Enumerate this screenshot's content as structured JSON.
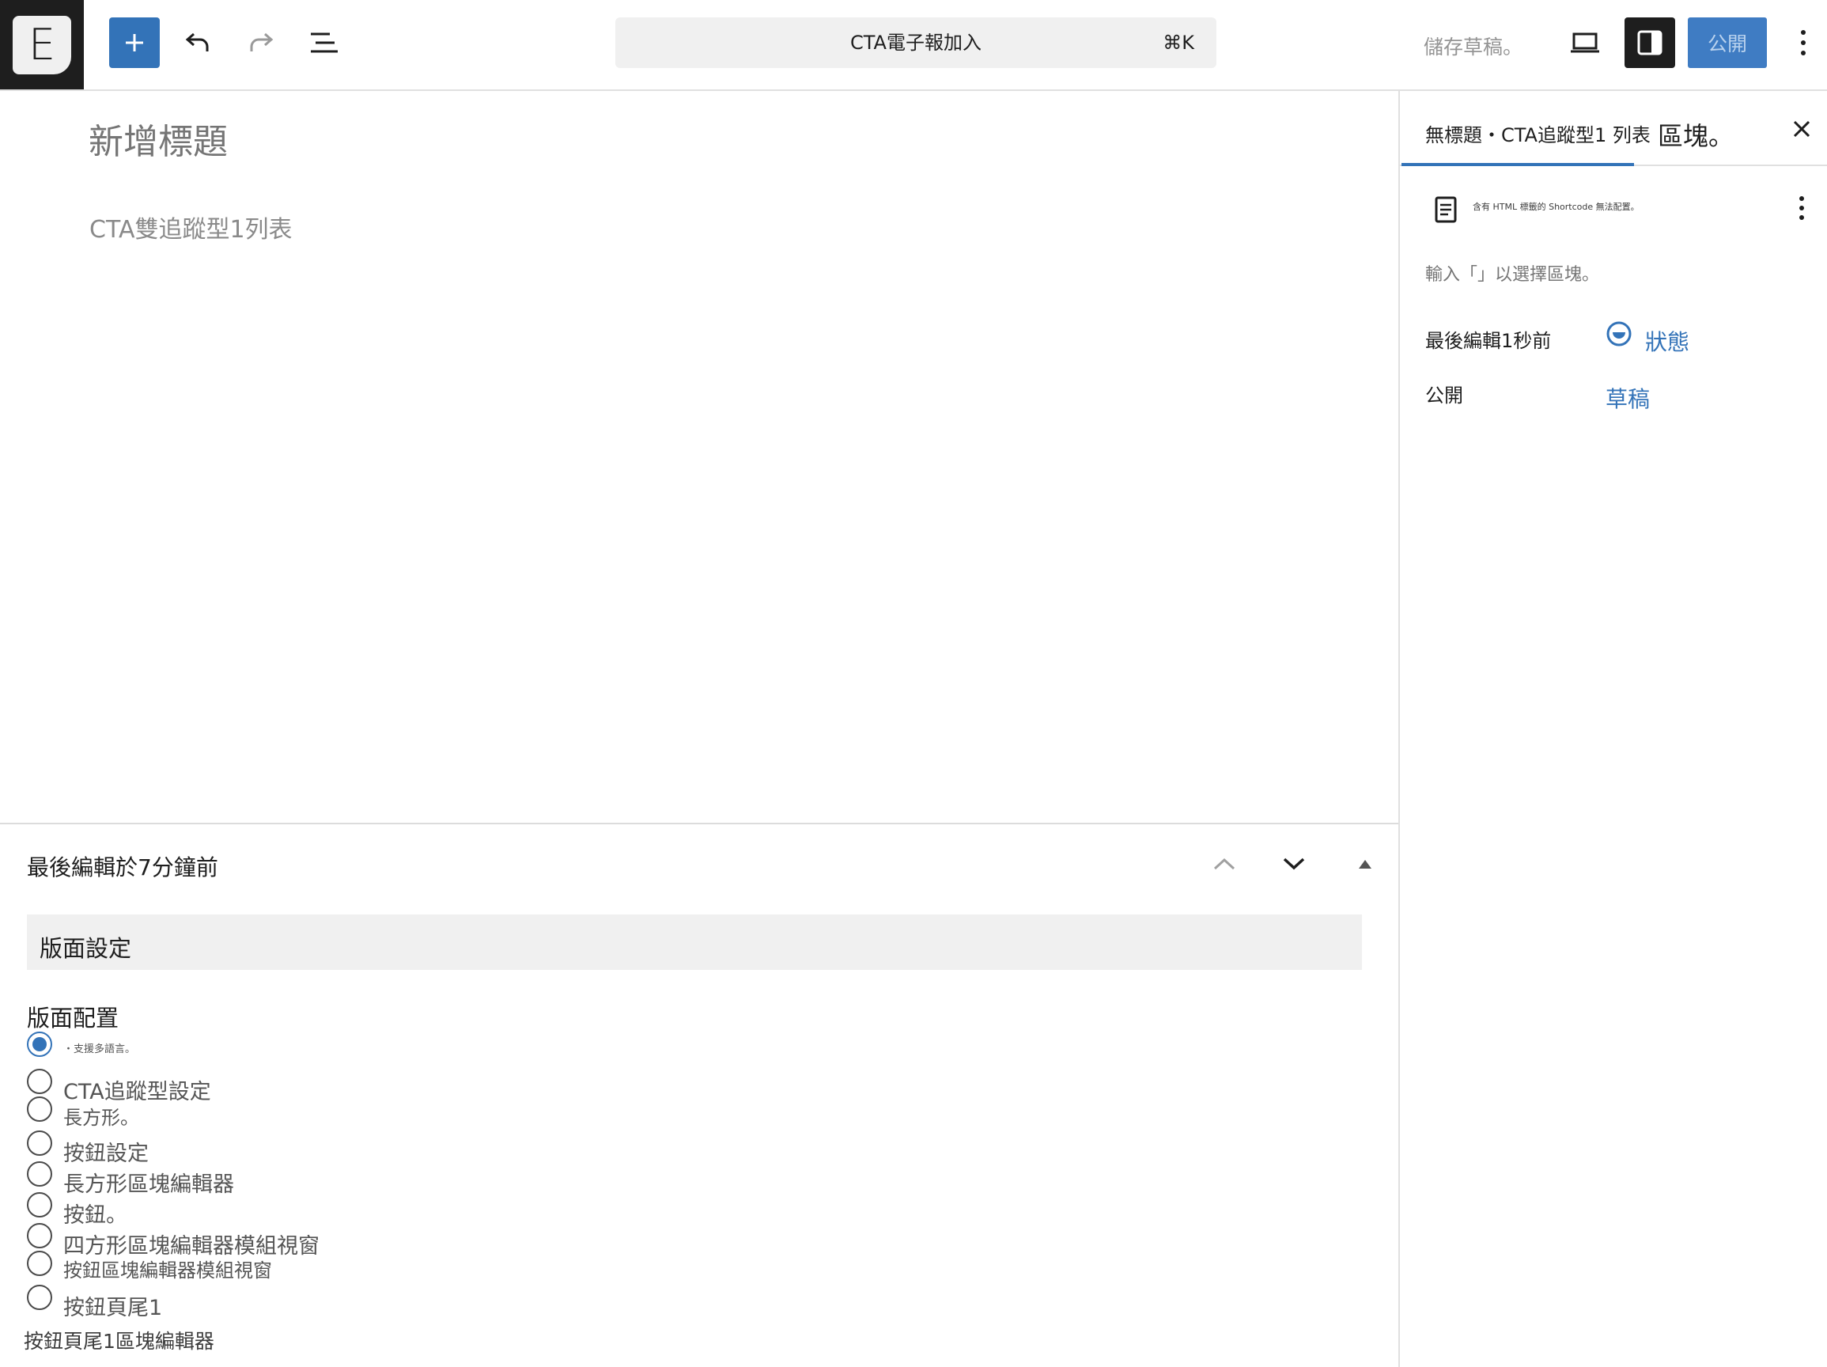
{
  "topbar": {
    "logo_letter": "E",
    "command_title": "CTA電子報加入",
    "command_shortcut": "⌘K",
    "save_draft_label": "儲存草稿。",
    "publish_label": "公開",
    "icons": [
      "plus-icon",
      "undo-icon",
      "redo-icon",
      "list-view-icon",
      "desktop-preview-icon",
      "sidebar-toggle-icon",
      "more-vertical-icon"
    ]
  },
  "editor": {
    "title_placeholder": "新增標題",
    "content_text": "CTA雙追蹤型1列表"
  },
  "metabox": {
    "header_text": "最後編輯於7分鐘前",
    "section_title": "版面設定",
    "config_label": "版面配置",
    "options": [
      {
        "label": "・支援多語言。",
        "checked": true
      },
      {
        "label": "CTA追蹤型設定",
        "checked": false
      },
      {
        "label": "長方形。",
        "checked": false
      },
      {
        "label": "按鈕設定",
        "checked": false
      },
      {
        "label": "長方形區塊編輯器",
        "checked": false
      },
      {
        "label": "按鈕。",
        "checked": false
      },
      {
        "label": "四方形區塊編輯器模組視窗",
        "checked": false
      },
      {
        "label": "按鈕區塊編輯器模組視窗",
        "checked": false
      },
      {
        "label": "按鈕頁尾1",
        "checked": false
      }
    ],
    "footer_text": "按鈕頁尾1區塊編輯器"
  },
  "sidebar": {
    "tab_document": "無標題・CTA追蹤型1 列表",
    "tab_block": "區塊。",
    "doc_note": "含有 HTML 標籤的 Shortcode 無法配置。",
    "hint": "輸入「」以選擇區塊。",
    "last_edited_label": "最後編輯1秒前",
    "status_link": "狀態",
    "visibility_label": "公開",
    "draft_link": "草稿"
  },
  "colors": {
    "accent": "#3373b8",
    "dark": "#1e1e1e",
    "muted": "#757575"
  }
}
